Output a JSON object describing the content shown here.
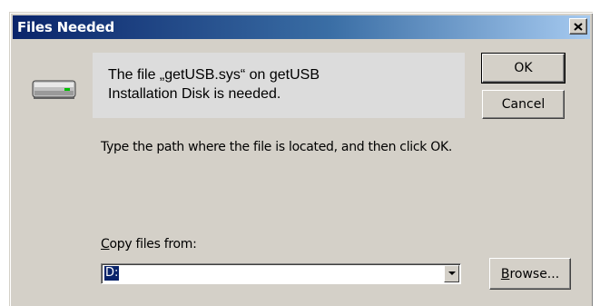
{
  "window": {
    "title": "Files Needed"
  },
  "message": {
    "text": "The file „getUSB.sys“ on getUSB\nInstallation Disk is needed."
  },
  "buttons": {
    "ok_label": "OK",
    "cancel_label": "Cancel",
    "browse_label_first": "B",
    "browse_label_rest": "rowse..."
  },
  "instruction": "Type the path where the file is located, and then click OK.",
  "copy_from": {
    "label_first": "C",
    "label_rest": "opy files from:",
    "value": "D:"
  },
  "icons": {
    "drive": "drive-icon",
    "close": "close-icon",
    "dropdown": "chevron-down-icon"
  },
  "colors": {
    "titlebar_start": "#0a246a",
    "titlebar_end": "#a6caf0",
    "dialog_bg": "#d4d0c8",
    "selection": "#0a246a"
  }
}
